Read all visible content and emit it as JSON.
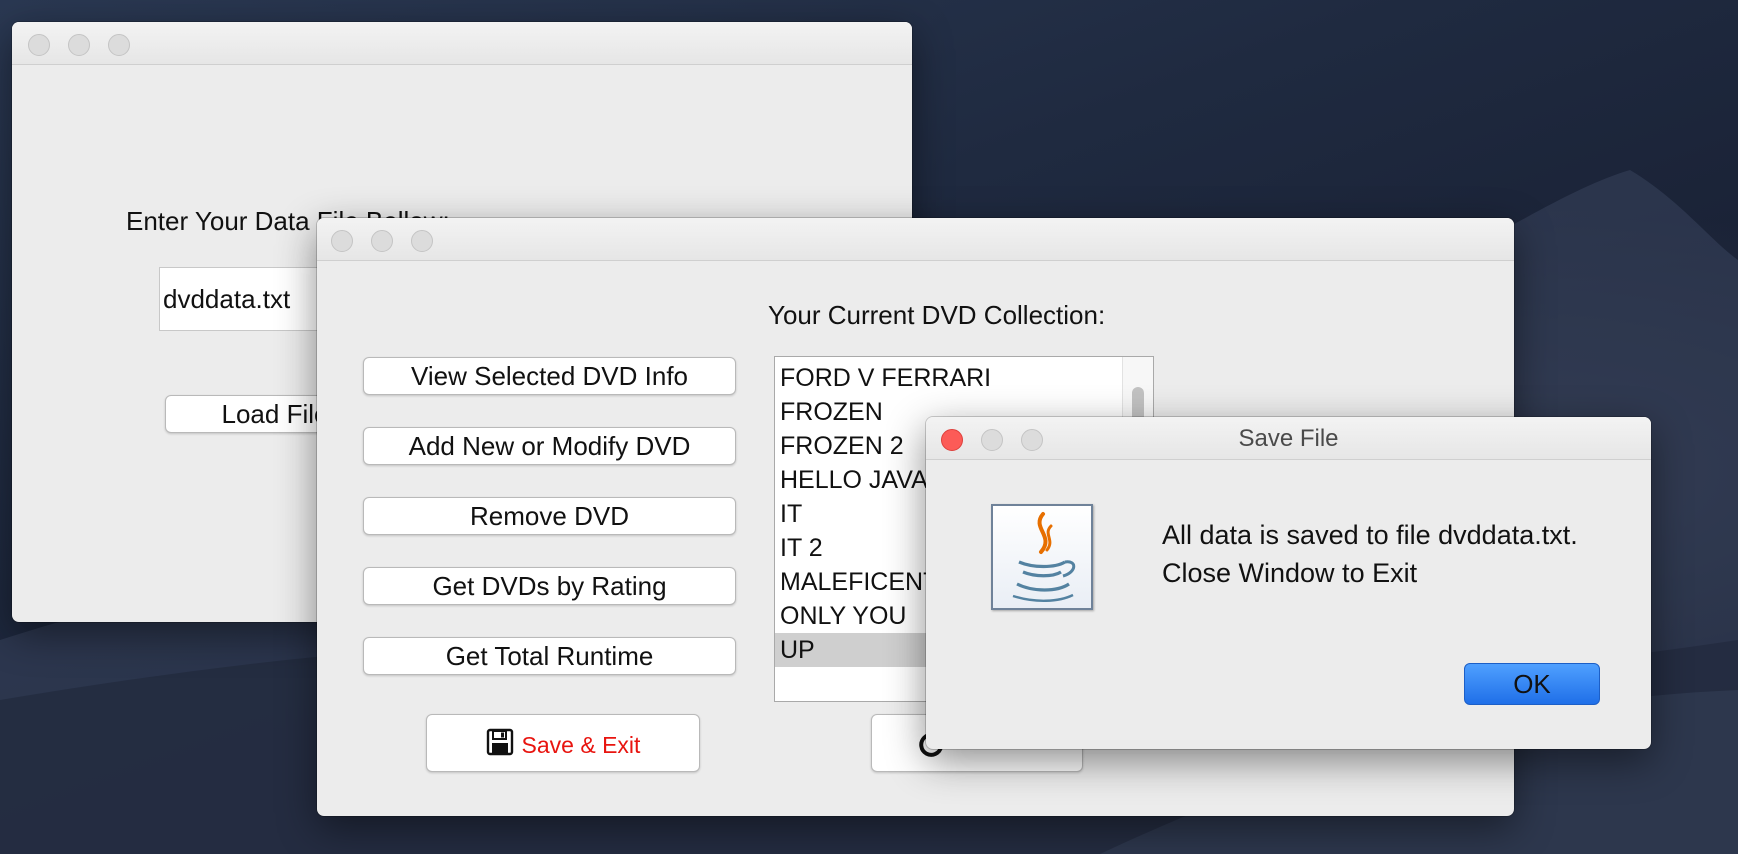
{
  "loader_window": {
    "prompt_label": "Enter Your Data File Bellow:",
    "filename_value": "dvddata.txt",
    "load_button_label": "Load File"
  },
  "main_window": {
    "collection_label": "Your Current DVD Collection:",
    "buttons": [
      "View Selected DVD Info",
      "Add New or Modify DVD",
      "Remove DVD",
      "Get DVDs by Rating",
      "Get Total Runtime"
    ],
    "save_exit_label": "Save & Exit",
    "save_exit_color": "#e8140f",
    "dvd_list": [
      "FORD V FERRARI",
      "FROZEN",
      "FROZEN 2",
      "HELLO JAVA",
      "IT",
      "IT 2",
      "MALEFICENT",
      "ONLY YOU",
      "UP"
    ],
    "selected_item": "UP"
  },
  "dialog": {
    "title": "Save File",
    "message_line1": "All data is saved to file dvddata.txt.",
    "message_line2": "Close Window to Exit",
    "ok_label": "OK",
    "icon": "java-icon"
  }
}
